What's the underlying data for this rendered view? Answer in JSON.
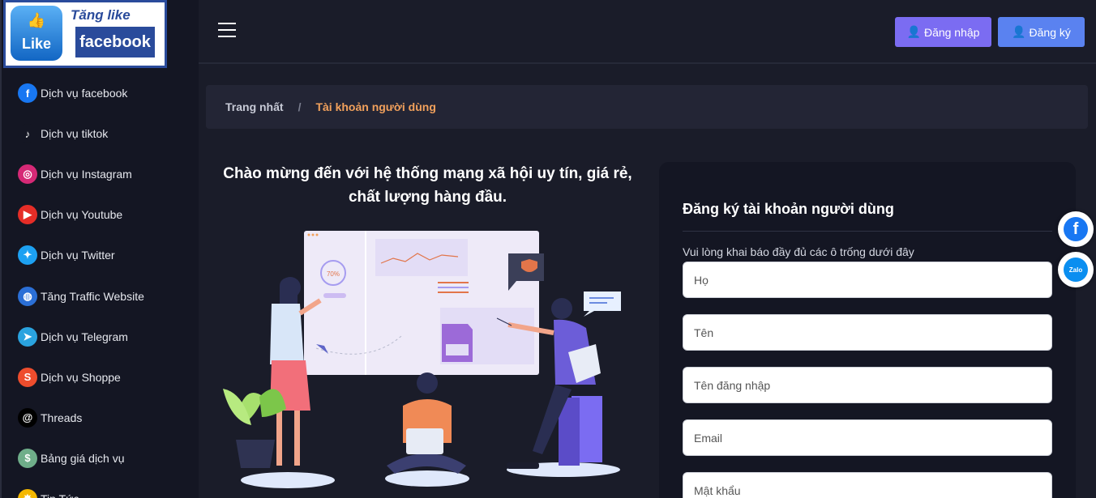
{
  "logo": {
    "like_text": "Like",
    "tang_like": "Tăng like",
    "facebook": "facebook"
  },
  "sidebar": {
    "items": [
      {
        "label": "Dịch vụ facebook",
        "icon": "facebook-icon",
        "color": "#1877f2",
        "glyph": "f"
      },
      {
        "label": "Dịch vụ tiktok",
        "icon": "tiktok-icon",
        "color": "#141623",
        "glyph": "♪"
      },
      {
        "label": "Dịch vụ Instagram",
        "icon": "instagram-icon",
        "color": "#d62976",
        "glyph": "◎"
      },
      {
        "label": "Dịch vụ Youtube",
        "icon": "youtube-icon",
        "color": "#e52d27",
        "glyph": "▶"
      },
      {
        "label": "Dịch vụ Twitter",
        "icon": "twitter-icon",
        "color": "#1da1f2",
        "glyph": "✦"
      },
      {
        "label": "Tăng Traffic Website",
        "icon": "globe-icon",
        "color": "#2b6fd6",
        "glyph": "◍"
      },
      {
        "label": "Dịch vụ Telegram",
        "icon": "telegram-icon",
        "color": "#2aa3df",
        "glyph": "➤"
      },
      {
        "label": "Dịch vụ Shoppe",
        "icon": "shopee-icon",
        "color": "#ee4d2d",
        "glyph": "S"
      },
      {
        "label": "Threads",
        "icon": "threads-icon",
        "color": "#000000",
        "glyph": "@"
      },
      {
        "label": "Bảng giá dịch vụ",
        "icon": "price-bag-icon",
        "color": "#6fae8a",
        "glyph": "$"
      },
      {
        "label": "Tin Tức",
        "icon": "news-icon",
        "color": "#f5b800",
        "glyph": "✸"
      }
    ]
  },
  "header": {
    "login_label": "Đăng nhập",
    "register_label": "Đăng ký"
  },
  "breadcrumb": {
    "home": "Trang nhất",
    "separator": "/",
    "current": "Tài khoản người dùng"
  },
  "welcome": {
    "line1": "Chào mừng đến với hệ thống mạng xã hội uy tín, giá rẻ,",
    "line2": "chất lượng hàng đầu."
  },
  "illustration": {
    "progress_label": "70%"
  },
  "form": {
    "title": "Đăng ký tài khoản người dùng",
    "note": "Vui lòng khai báo đầy đủ các ô trống dưới đây",
    "fields": [
      {
        "placeholder": "Họ"
      },
      {
        "placeholder": "Tên"
      },
      {
        "placeholder": "Tên đăng nhập"
      },
      {
        "placeholder": "Email"
      },
      {
        "placeholder": "Mật khẩu"
      }
    ]
  },
  "floating": {
    "facebook_glyph": "f",
    "zalo_label": "Zalo"
  },
  "colors": {
    "login": "#7b6cf2",
    "register": "#5a82f0",
    "accent": "#f2a15c"
  }
}
